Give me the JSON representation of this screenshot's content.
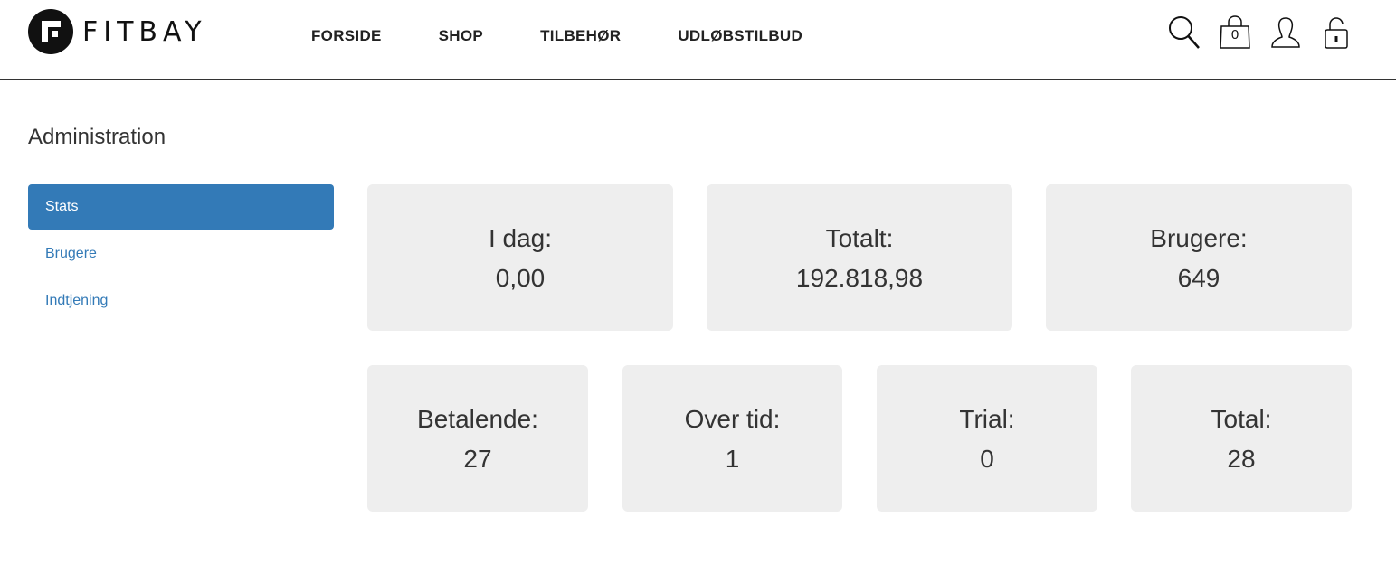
{
  "header": {
    "logo_text": "FITBAY",
    "nav": [
      {
        "label": "FORSIDE"
      },
      {
        "label": "SHOP"
      },
      {
        "label": "TILBEHØR"
      },
      {
        "label": "UDLØBSTILBUD"
      }
    ],
    "cart_count": "0",
    "icons": [
      "search-icon",
      "shopping-bag-icon",
      "user-icon",
      "lock-icon"
    ]
  },
  "page": {
    "title": "Administration"
  },
  "sidebar": {
    "items": [
      {
        "label": "Stats",
        "active": true
      },
      {
        "label": "Brugere",
        "active": false
      },
      {
        "label": "Indtjening",
        "active": false
      }
    ]
  },
  "stats": {
    "row1": [
      {
        "label": "I dag:",
        "value": "0,00"
      },
      {
        "label": "Totalt:",
        "value": "192.818,98"
      },
      {
        "label": "Brugere:",
        "value": "649"
      }
    ],
    "row2": [
      {
        "label": "Betalende:",
        "value": "27"
      },
      {
        "label": "Over tid:",
        "value": "1"
      },
      {
        "label": "Trial:",
        "value": "0"
      },
      {
        "label": "Total:",
        "value": "28"
      }
    ]
  },
  "colors": {
    "accent": "#337ab7",
    "card_bg": "#eeeeee",
    "text": "#333333"
  }
}
